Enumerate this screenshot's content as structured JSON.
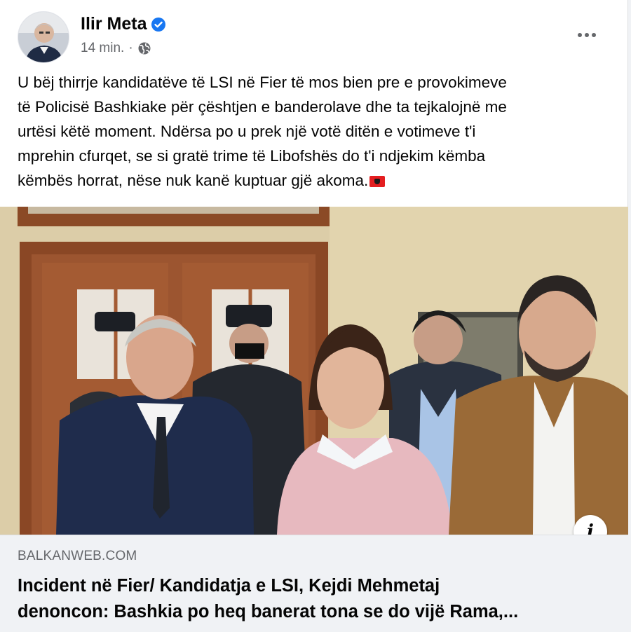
{
  "post": {
    "author": "Ilir Meta",
    "time": "14 min.",
    "separator": "·",
    "text_lines": [
      "U bëj thirrje kandidatëve të LSI në Fier të mos bien pre e provokimeve",
      "të Policisë Bashkiake për çështjen e banderolave dhe ta tejkalojnë me",
      "urtësi këtë moment. Ndërsa po u prek një votë ditën e votimeve t'i",
      "mprehin cfurqet, se si gratë trime të Libofshës do t'i ndjekim këmba",
      "këmbës horrat, nëse nuk kanë kuptuar gjë akoma."
    ]
  },
  "link_preview": {
    "domain": "BALKANWEB.COM",
    "title_lines": [
      "Incident në Fier/ Kandidatja e LSI, Kejdi Mehmetaj",
      "denoncon: Bashkia po heq banerat tona se do vijë Rama,..."
    ]
  },
  "icons": {
    "verified": "verified-badge-icon",
    "audience": "globe-icon",
    "more": "more-options-icon",
    "info": "info-icon",
    "flag": "albania-flag-icon"
  },
  "colors": {
    "verified": "#1877f2",
    "secondary_text": "#65676b",
    "primary_text": "#050505",
    "link_box_bg": "#f0f2f5"
  }
}
